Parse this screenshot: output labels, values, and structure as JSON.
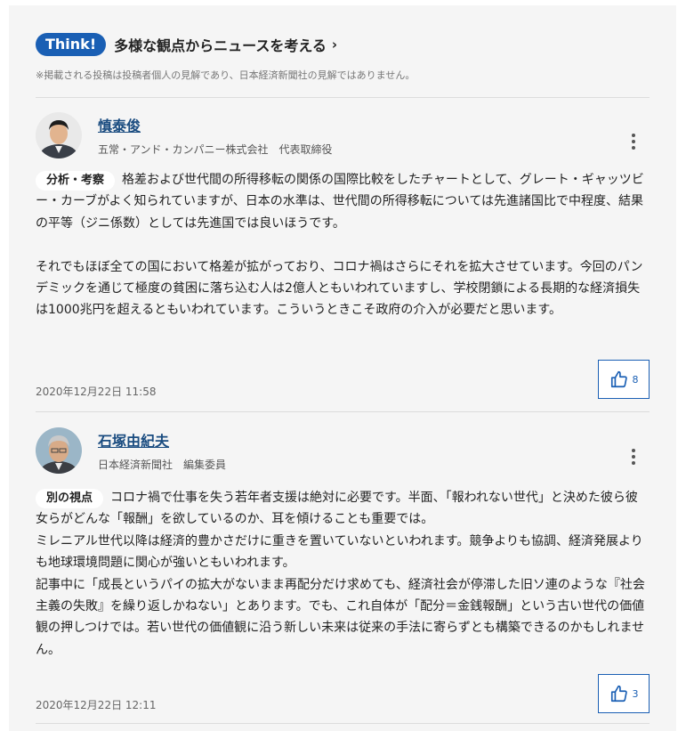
{
  "header": {
    "badge": "Think!",
    "title": "多様な観点からニュースを考える",
    "chevron": "›",
    "disclaimer": "※掲載される投稿は投稿者個人の見解であり、日本経済新聞社の見解ではありません。"
  },
  "comments": [
    {
      "author": "慎泰俊",
      "affiliation": "五常・アンド・カンパニー株式会社　代表取締役",
      "tag": "分析・考察",
      "paragraphs": [
        "格差および世代間の所得移転の関係の国際比較をしたチャートとして、グレート・ギャッツビー・カーブがよく知られていますが、日本の水準は、世代間の所得移転については先進諸国比で中程度、結果の平等（ジニ係数）としては先進国では良いほうです。",
        "",
        "それでもほぼ全ての国において格差が拡がっており、コロナ禍はさらにそれを拡大させています。今回のパンデミックを通じて極度の貧困に落ち込む人は2億人ともいわれていますし、学校閉鎖による長期的な経済損失は1000兆円を超えるともいわれています。こういうときこそ政府の介入が必要だと思います。"
      ],
      "date": "2020年12月22日 11:58",
      "likes": "8"
    },
    {
      "author": "石塚由紀夫",
      "affiliation": "日本経済新聞社　編集委員",
      "tag": "別の視点",
      "paragraphs": [
        "コロナ禍で仕事を失う若年者支援は絶対に必要です。半面、「報われない世代」と決めた彼ら彼女らがどんな「報酬」を欲しているのか、耳を傾けることも重要では。",
        "ミレニアル世代以降は経済的豊かさだけに重きを置いていないといわれます。競争よりも協調、経済発展よりも地球環境問題に関心が強いともいわれます。",
        "記事中に「成長というパイの拡大がないまま再配分だけ求めても、経済社会が停滞した旧ソ連のような『社会主義の失敗』を繰り返しかねない」とあります。でも、これ自体が「配分＝金銭報酬」という古い世代の価値観の押しつけでは。若い世代の価値観に沿う新しい未来は従来の手法に寄らずとも構築できるのかもしれません。"
      ],
      "date": "2020年12月22日 12:11",
      "likes": "3"
    }
  ],
  "icons": {
    "like": "thumbs-up-icon",
    "more": "vertical-dots-icon"
  },
  "colors": {
    "accent": "#1a5fb4",
    "author_link": "#1a4c80",
    "background": "#f5f5f5"
  }
}
